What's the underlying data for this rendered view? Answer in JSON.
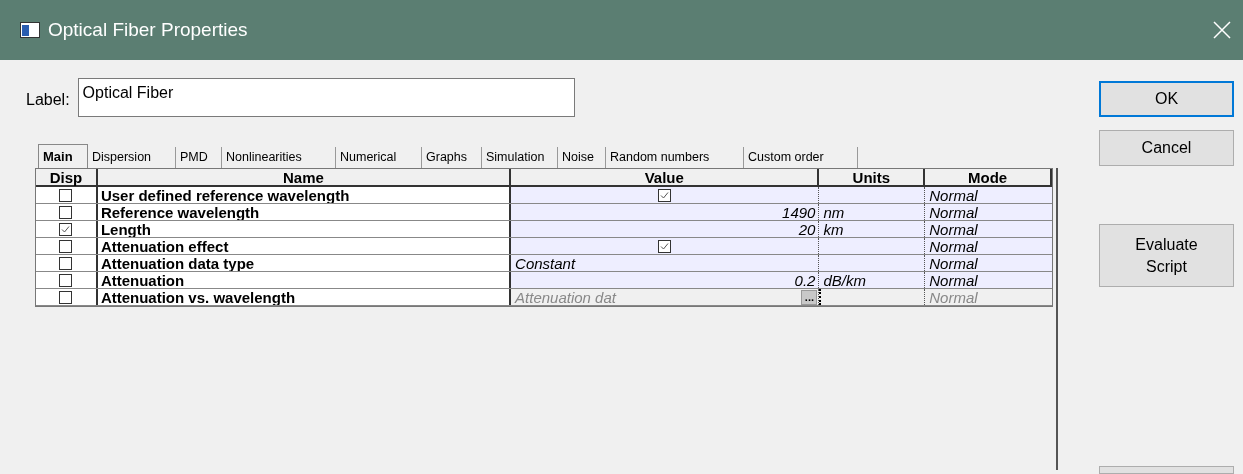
{
  "window": {
    "title": "Optical Fiber Properties"
  },
  "label": {
    "caption": "Label:",
    "value": "Optical Fiber"
  },
  "tabs": [
    {
      "label": "Main",
      "selected": true
    },
    {
      "label": "Dispersion",
      "selected": false
    },
    {
      "label": "PMD",
      "selected": false
    },
    {
      "label": "Nonlinearities",
      "selected": false
    },
    {
      "label": "Numerical",
      "selected": false
    },
    {
      "label": "Graphs",
      "selected": false
    },
    {
      "label": "Simulation",
      "selected": false
    },
    {
      "label": "Noise",
      "selected": false
    },
    {
      "label": "Random numbers",
      "selected": false
    },
    {
      "label": "Custom order",
      "selected": false
    }
  ],
  "table": {
    "columns": [
      "Disp",
      "Name",
      "Value",
      "Units",
      "Mode"
    ],
    "rows": [
      {
        "disp": false,
        "name": "User defined reference wavelength",
        "value": {
          "kind": "checkbox",
          "checked": true
        },
        "units": "",
        "mode": "Normal",
        "disabled": false
      },
      {
        "disp": false,
        "name": "Reference wavelength",
        "value": {
          "kind": "number",
          "text": "1490"
        },
        "units": "nm",
        "mode": "Normal",
        "disabled": false
      },
      {
        "disp": true,
        "name": "Length",
        "value": {
          "kind": "number",
          "text": "20"
        },
        "units": "km",
        "mode": "Normal",
        "disabled": false
      },
      {
        "disp": false,
        "name": "Attenuation effect",
        "value": {
          "kind": "checkbox",
          "checked": true
        },
        "units": "",
        "mode": "Normal",
        "disabled": false
      },
      {
        "disp": false,
        "name": "Attenuation data type",
        "value": {
          "kind": "text",
          "text": "Constant"
        },
        "units": "",
        "mode": "Normal",
        "disabled": false
      },
      {
        "disp": false,
        "name": "Attenuation",
        "value": {
          "kind": "number",
          "text": "0.2"
        },
        "units": "dB/km",
        "mode": "Normal",
        "disabled": false
      },
      {
        "disp": false,
        "name": "Attenuation vs. wavelength",
        "value": {
          "kind": "file",
          "text": "Attenuation dat",
          "button": "..."
        },
        "units": "",
        "mode": "Normal",
        "disabled": true
      }
    ]
  },
  "buttons": [
    {
      "label": "OK",
      "kind": "default"
    },
    {
      "label": "Cancel",
      "kind": "normal"
    },
    {
      "label": "Evaluate Script",
      "kind": "tall"
    }
  ]
}
